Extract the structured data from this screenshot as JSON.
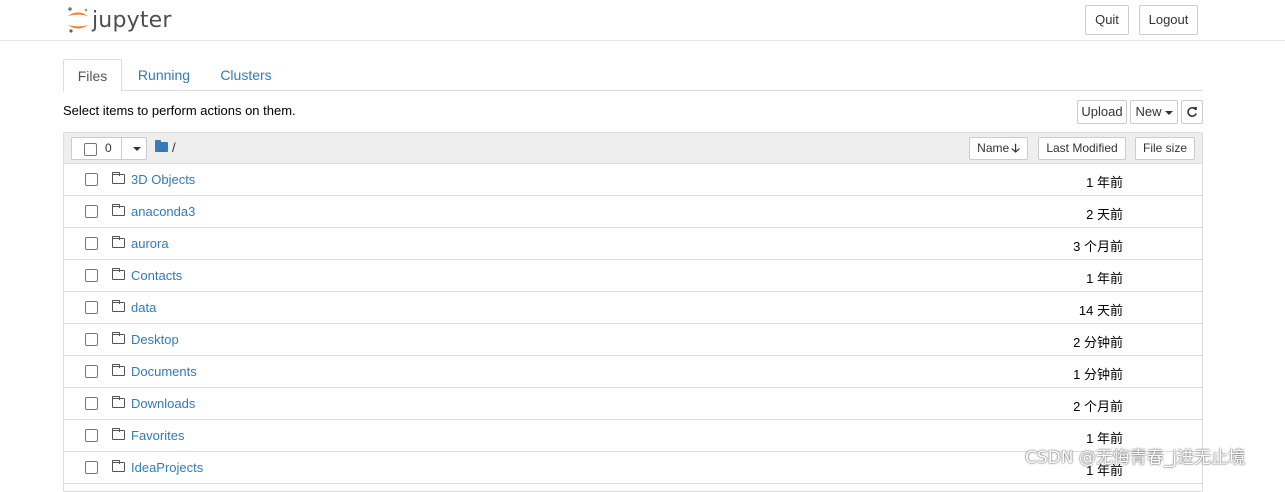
{
  "header": {
    "logo_text": "jupyter",
    "quit_label": "Quit",
    "logout_label": "Logout"
  },
  "tabs": [
    {
      "label": "Files",
      "active": true
    },
    {
      "label": "Running",
      "active": false
    },
    {
      "label": "Clusters",
      "active": false
    }
  ],
  "toolbar": {
    "instruction": "Select items to perform actions on them.",
    "upload_label": "Upload",
    "new_label": "New"
  },
  "list_header": {
    "selected_count": "0",
    "breadcrumb": "/",
    "name_label": "Name",
    "last_modified_label": "Last Modified",
    "file_size_label": "File size"
  },
  "items": [
    {
      "name": "3D Objects",
      "modified": "1 年前"
    },
    {
      "name": "anaconda3",
      "modified": "2 天前"
    },
    {
      "name": "aurora",
      "modified": "3 个月前"
    },
    {
      "name": "Contacts",
      "modified": "1 年前"
    },
    {
      "name": "data",
      "modified": "14 天前"
    },
    {
      "name": "Desktop",
      "modified": "2 分钟前"
    },
    {
      "name": "Documents",
      "modified": "1 分钟前"
    },
    {
      "name": "Downloads",
      "modified": "2 个月前"
    },
    {
      "name": "Favorites",
      "modified": "1 年前"
    },
    {
      "name": "IdeaProjects",
      "modified": "1 年前"
    }
  ],
  "watermark": "CSDN @无悔青春_j进无止境",
  "colors": {
    "link": "#337ab7",
    "logo_orange": "#f37726",
    "logo_gray": "#767677"
  }
}
